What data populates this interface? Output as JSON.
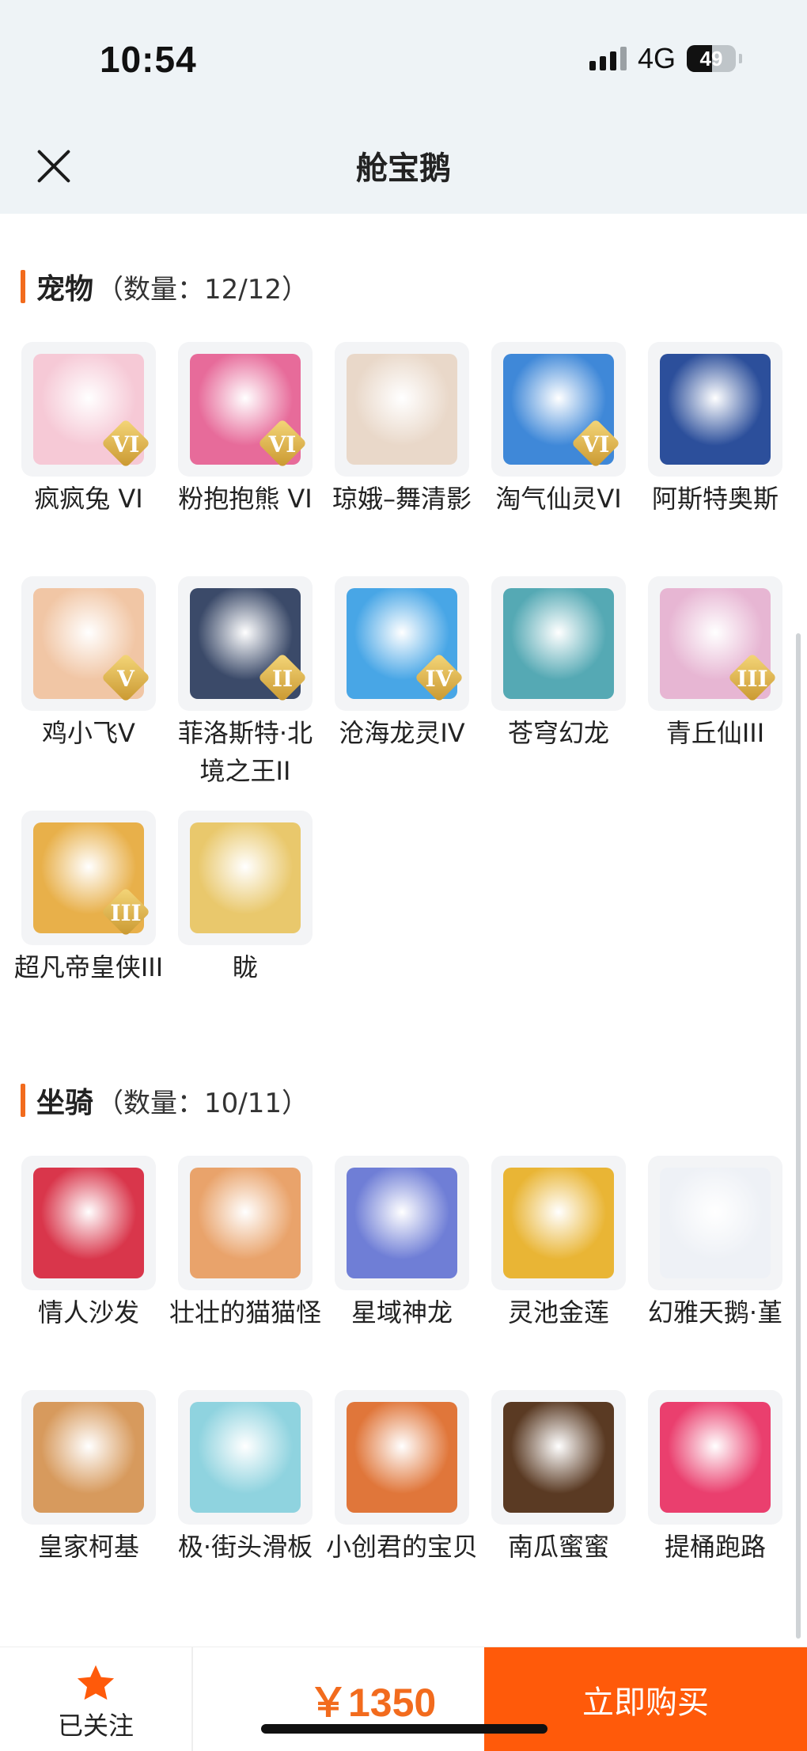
{
  "status_bar": {
    "time": "10:54",
    "network": "4G",
    "battery": "49"
  },
  "header": {
    "title": "舱宝鹅"
  },
  "pets": {
    "title": "宠物",
    "count": "（数量：12/12）",
    "items": [
      {
        "label": "疯疯兔 VI",
        "badge": "VI",
        "color": "#f6c9d6"
      },
      {
        "label": "粉抱抱熊 VI",
        "badge": "VI",
        "color": "#e76b9a"
      },
      {
        "label": "琼娥–舞清影",
        "badge": "",
        "color": "#e9d8c9"
      },
      {
        "label": "淘气仙灵VI",
        "badge": "VI",
        "color": "#3f88d8"
      },
      {
        "label": "阿斯特奥斯",
        "badge": "",
        "color": "#2c4f9b"
      },
      {
        "label": "鸡小飞V",
        "badge": "V",
        "color": "#f1c6a5"
      },
      {
        "label": "菲洛斯特·北境之王II",
        "badge": "II",
        "color": "#3b4a69"
      },
      {
        "label": "沧海龙灵IV",
        "badge": "IV",
        "color": "#48a6e6"
      },
      {
        "label": "苍穹幻龙",
        "badge": "",
        "color": "#55a9b4"
      },
      {
        "label": "青丘仙III",
        "badge": "III",
        "color": "#e7b6d3"
      },
      {
        "label": "超凡帝皇侠III",
        "badge": "III",
        "color": "#e8b04a"
      },
      {
        "label": "眬",
        "badge": "",
        "color": "#e9c86c"
      }
    ]
  },
  "mounts": {
    "title": "坐骑",
    "count": "（数量：10/11）",
    "items": [
      {
        "label": "情人沙发",
        "badge": "",
        "color": "#d9364b"
      },
      {
        "label": "壮壮的猫猫怪",
        "badge": "",
        "color": "#e9a36b"
      },
      {
        "label": "星域神龙",
        "badge": "",
        "color": "#6f7ed6"
      },
      {
        "label": "灵池金莲",
        "badge": "",
        "color": "#e9b535"
      },
      {
        "label": "幻雅天鹅·堇",
        "badge": "",
        "color": "#eef1f6"
      },
      {
        "label": "皇家柯基",
        "badge": "",
        "color": "#d79a5d"
      },
      {
        "label": "极·街头滑板",
        "badge": "",
        "color": "#8fd3df"
      },
      {
        "label": "小创君的宝贝",
        "badge": "",
        "color": "#e0763a"
      },
      {
        "label": "南瓜蜜蜜",
        "badge": "",
        "color": "#5a3a23"
      },
      {
        "label": "提桶跑路",
        "badge": "",
        "color": "#ea3f6e"
      }
    ]
  },
  "footer": {
    "follow_label": "已关注",
    "price": "￥1350",
    "buy_label": "立即购买",
    "accent": "#ff5a0a"
  }
}
